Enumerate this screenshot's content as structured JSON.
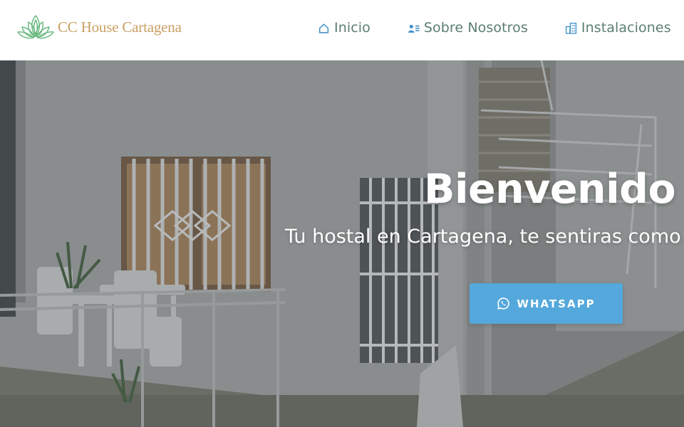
{
  "brand": {
    "name": "CC House Cartagena",
    "logo_icon": "lotus-icon",
    "logo_color": "#62b67a",
    "name_color": "#c9a063"
  },
  "nav": {
    "items": [
      {
        "label": "Inicio",
        "icon": "home-icon"
      },
      {
        "label": "Sobre Nosotros",
        "icon": "user-card-icon"
      },
      {
        "label": "Instalaciones",
        "icon": "building-icon"
      }
    ],
    "text_color": "#5b7e70",
    "icon_color": "#3d8fc9"
  },
  "hero": {
    "title": "Bienvenido",
    "subtitle": "Tu hostal en Cartagena, te sentiras como en casa",
    "cta": {
      "label": "WHATSAPP",
      "icon": "whatsapp-icon",
      "background": "#54a8dc"
    }
  }
}
